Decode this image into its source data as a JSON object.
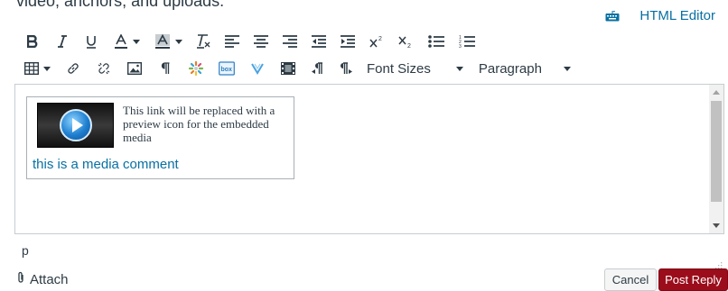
{
  "top_cut_text": "video, anchors, and uploads.",
  "html_editor": {
    "label": "HTML Editor",
    "icon": "keyboard-icon"
  },
  "toolbar": {
    "font_sizes_label": "Font Sizes",
    "paragraph_label": "Paragraph"
  },
  "editor": {
    "media_placeholder": "This link will be replaced with a preview icon for the embedded media",
    "media_link_text": "this is a media comment"
  },
  "status": {
    "path": "p"
  },
  "footer": {
    "attach_label": "Attach",
    "cancel_label": "Cancel",
    "post_label": "Post Reply"
  },
  "colors": {
    "link": "#0770a3",
    "primary_button": "#9b0d1b",
    "text": "#2d3b45"
  }
}
